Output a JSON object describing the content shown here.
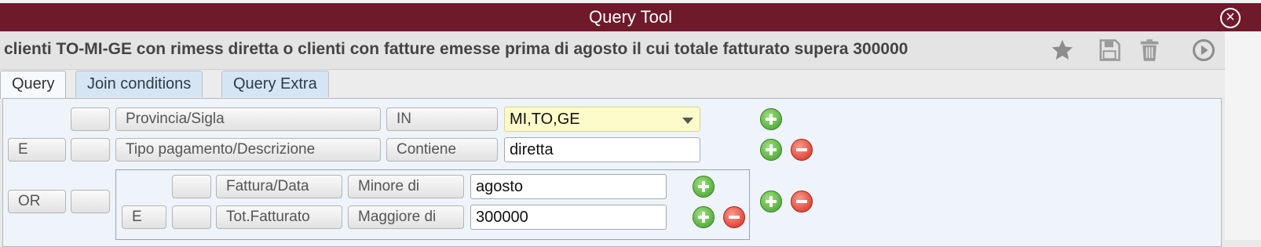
{
  "window": {
    "title": "Query Tool"
  },
  "query": {
    "description": "clienti TO-MI-GE con rimess diretta o clienti con fatture emesse prima di agosto il cui totale fatturato supera 300000"
  },
  "toolbar": {
    "favorite": "favorite-star-icon",
    "save": "save-icon",
    "delete": "trash-icon",
    "run": "run-icon"
  },
  "tabs": [
    {
      "label": "Query",
      "active": true
    },
    {
      "label": "Join conditions",
      "active": false
    },
    {
      "label": "Query Extra",
      "active": false
    }
  ],
  "conditions": [
    {
      "joiner": "",
      "field": "Provincia/Sigla",
      "operator": "IN",
      "value": "MI,TO,GE"
    },
    {
      "joiner": "E",
      "field": "Tipo pagamento/Descrizione",
      "operator": "Contiene",
      "value": "diretta"
    }
  ],
  "group": {
    "joiner": "OR",
    "conditions": [
      {
        "joiner": "",
        "field": "Fattura/Data",
        "operator": "Minore di",
        "value": "agosto"
      },
      {
        "joiner": "E",
        "field": "Tot.Fatturato",
        "operator": "Maggiore di",
        "value": "300000"
      }
    ]
  },
  "colors": {
    "titlebar": "#6e1a2b",
    "value_highlight": "#fdfbc9",
    "add": "#3f9b2c",
    "remove": "#d2291c"
  }
}
